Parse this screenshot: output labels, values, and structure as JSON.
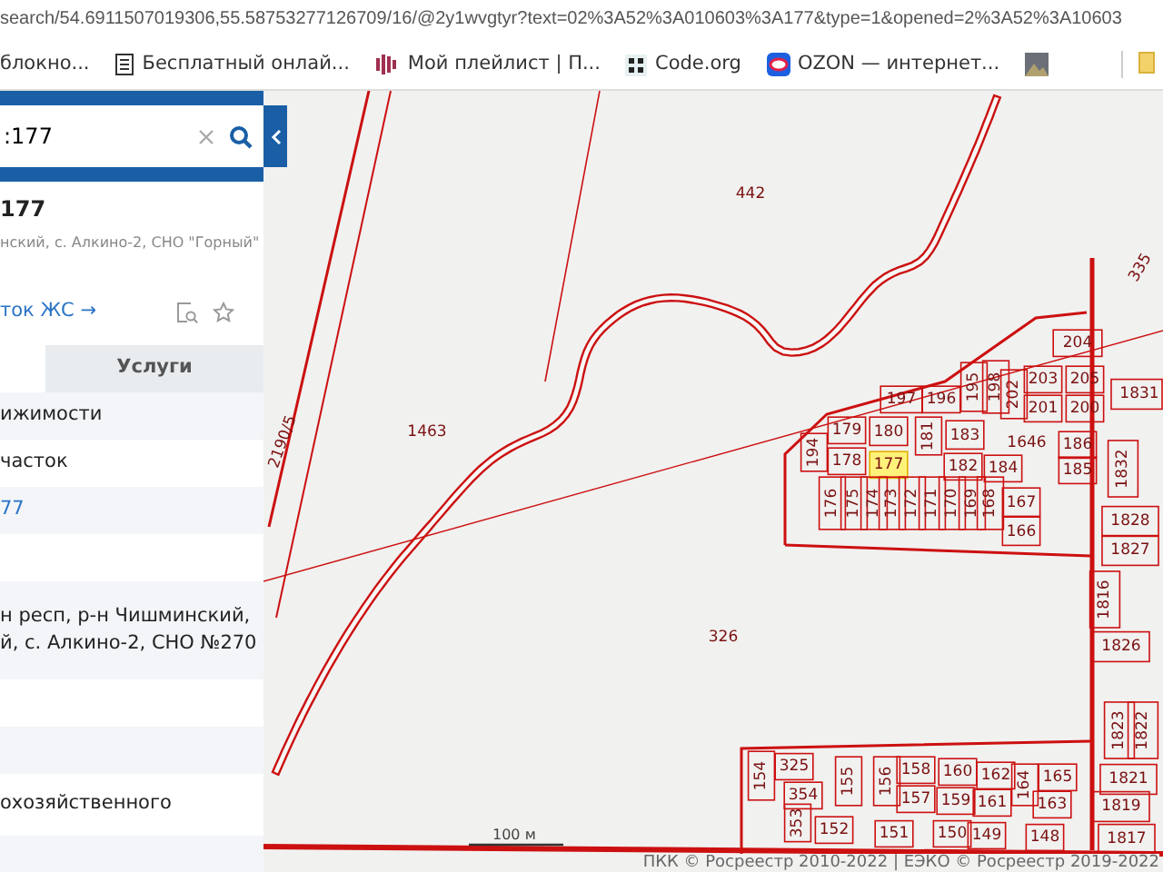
{
  "browser": {
    "url": "search/54.6911507019306,55.58753277126709/16/@2y1wvgtyr?text=02%3A52%3A010603%3A177&type=1&opened=2%3A52%3A10603",
    "bookmarks": [
      {
        "label": "блокно...",
        "kind": "plain"
      },
      {
        "label": "Бесплатный онлай...",
        "kind": "notepad"
      },
      {
        "label": "Мой плейлист | П...",
        "kind": "wave"
      },
      {
        "label": "Code.org",
        "kind": "grid"
      },
      {
        "label": "OZON — интернет...",
        "kind": "ozon"
      },
      {
        "kind": "image"
      }
    ]
  },
  "panel": {
    "search": {
      "value": ":177"
    },
    "title": "177",
    "address": "нский, с. Алкино-2, СНО \"Горный\"",
    "link": "ток ЖС →",
    "tabs": [
      {
        "label": "Услуги",
        "selected": false
      }
    ],
    "rows": [
      {
        "kind": "text",
        "text": "ижимости"
      },
      {
        "kind": "text",
        "text": "часток"
      },
      {
        "kind": "link",
        "text": "77"
      },
      {
        "kind": "blank"
      },
      {
        "kind": "text",
        "text": "н респ, р-н Чишминский, й, с. Алкино-2, СНО №270"
      },
      {
        "kind": "blank"
      },
      {
        "kind": "blank"
      },
      {
        "kind": "text",
        "text": "охозяйственного"
      },
      {
        "kind": "blank"
      }
    ]
  },
  "map": {
    "labels": [
      "442",
      "1463",
      "326",
      "1646",
      "2190/5",
      "335"
    ],
    "parcels": [
      {
        "label": "204",
        "selected": false
      },
      {
        "label": "203",
        "selected": false
      },
      {
        "label": "205",
        "selected": false
      },
      {
        "label": "201",
        "selected": false
      },
      {
        "label": "200",
        "selected": false
      },
      {
        "label": "202",
        "selected": false
      },
      {
        "label": "198",
        "selected": false
      },
      {
        "label": "195",
        "selected": false
      },
      {
        "label": "197",
        "selected": false
      },
      {
        "label": "196",
        "selected": false
      },
      {
        "label": "179",
        "selected": false
      },
      {
        "label": "180",
        "selected": false
      },
      {
        "label": "181",
        "selected": false
      },
      {
        "label": "183",
        "selected": false
      },
      {
        "label": "194",
        "selected": false
      },
      {
        "label": "178",
        "selected": false
      },
      {
        "label": "177",
        "selected": true
      },
      {
        "label": "182",
        "selected": false
      },
      {
        "label": "184",
        "selected": false
      },
      {
        "label": "186",
        "selected": false
      },
      {
        "label": "185",
        "selected": false
      },
      {
        "label": "176",
        "selected": false
      },
      {
        "label": "175",
        "selected": false
      },
      {
        "label": "174",
        "selected": false
      },
      {
        "label": "173",
        "selected": false
      },
      {
        "label": "172",
        "selected": false
      },
      {
        "label": "171",
        "selected": false
      },
      {
        "label": "170",
        "selected": false
      },
      {
        "label": "169",
        "selected": false
      },
      {
        "label": "168",
        "selected": false
      },
      {
        "label": "167",
        "selected": false
      },
      {
        "label": "166",
        "selected": false
      },
      {
        "label": "1831",
        "selected": false
      },
      {
        "label": "1832",
        "selected": false
      },
      {
        "label": "1828",
        "selected": false
      },
      {
        "label": "1827",
        "selected": false
      },
      {
        "label": "1826",
        "selected": false
      },
      {
        "label": "1816",
        "selected": false
      },
      {
        "label": "154",
        "selected": false
      },
      {
        "label": "325",
        "selected": false
      },
      {
        "label": "354",
        "selected": false
      },
      {
        "label": "353",
        "selected": false
      },
      {
        "label": "152",
        "selected": false
      },
      {
        "label": "155",
        "selected": false
      },
      {
        "label": "156",
        "selected": false
      },
      {
        "label": "158",
        "selected": false
      },
      {
        "label": "160",
        "selected": false
      },
      {
        "label": "162",
        "selected": false
      },
      {
        "label": "164",
        "selected": false
      },
      {
        "label": "165",
        "selected": false
      },
      {
        "label": "157",
        "selected": false
      },
      {
        "label": "159",
        "selected": false
      },
      {
        "label": "161",
        "selected": false
      },
      {
        "label": "163",
        "selected": false
      },
      {
        "label": "151",
        "selected": false
      },
      {
        "label": "150",
        "selected": false
      },
      {
        "label": "149",
        "selected": false
      },
      {
        "label": "148",
        "selected": false
      },
      {
        "label": "1823",
        "selected": false
      },
      {
        "label": "1822",
        "selected": false
      },
      {
        "label": "1821",
        "selected": false
      },
      {
        "label": "1819",
        "selected": false
      },
      {
        "label": "1817",
        "selected": false
      }
    ],
    "scale": "100 м",
    "attribution": "ПКК © Росреестр 2010-2022 | ЕЭКО © Росреестр 2019-2022"
  }
}
